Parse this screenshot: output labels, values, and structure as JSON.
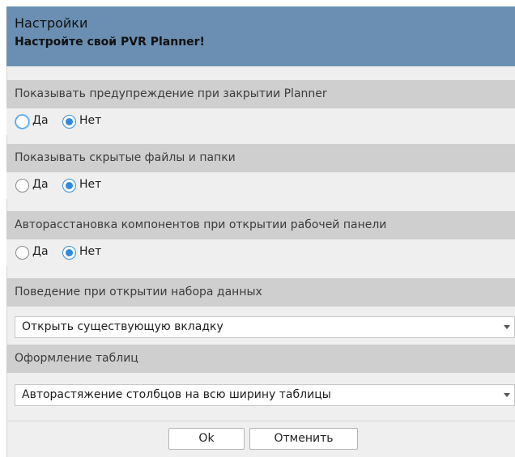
{
  "header": {
    "title": "Настройки",
    "subtitle": "Настройте свой PVR Planner!"
  },
  "settings": [
    {
      "label": "Показывать предупреждение при закрытии Planner",
      "type": "radio",
      "options": [
        "Да",
        "Нет"
      ],
      "selected": "Нет"
    },
    {
      "label": "Показывать скрытые файлы и папки",
      "type": "radio",
      "options": [
        "Да",
        "Нет"
      ],
      "selected": "Нет"
    },
    {
      "label": "Авторасстановка компонентов при открытии рабочей панели",
      "type": "radio",
      "options": [
        "Да",
        "Нет"
      ],
      "selected": "Нет"
    },
    {
      "label": "Поведение при открытии набора данных",
      "type": "select",
      "value": "Открыть существующую вкладку"
    },
    {
      "label": "Оформление таблиц",
      "type": "select",
      "value": "Авторастяжение столбцов на всю ширину таблицы"
    }
  ],
  "buttons": {
    "ok": "Ok",
    "cancel": "Отменить"
  },
  "colors": {
    "header_bg": "#6a8fb2",
    "section_bg": "#cfcfcf",
    "panel_bg": "#efefef",
    "radio_accent": "#2f8ae0"
  }
}
